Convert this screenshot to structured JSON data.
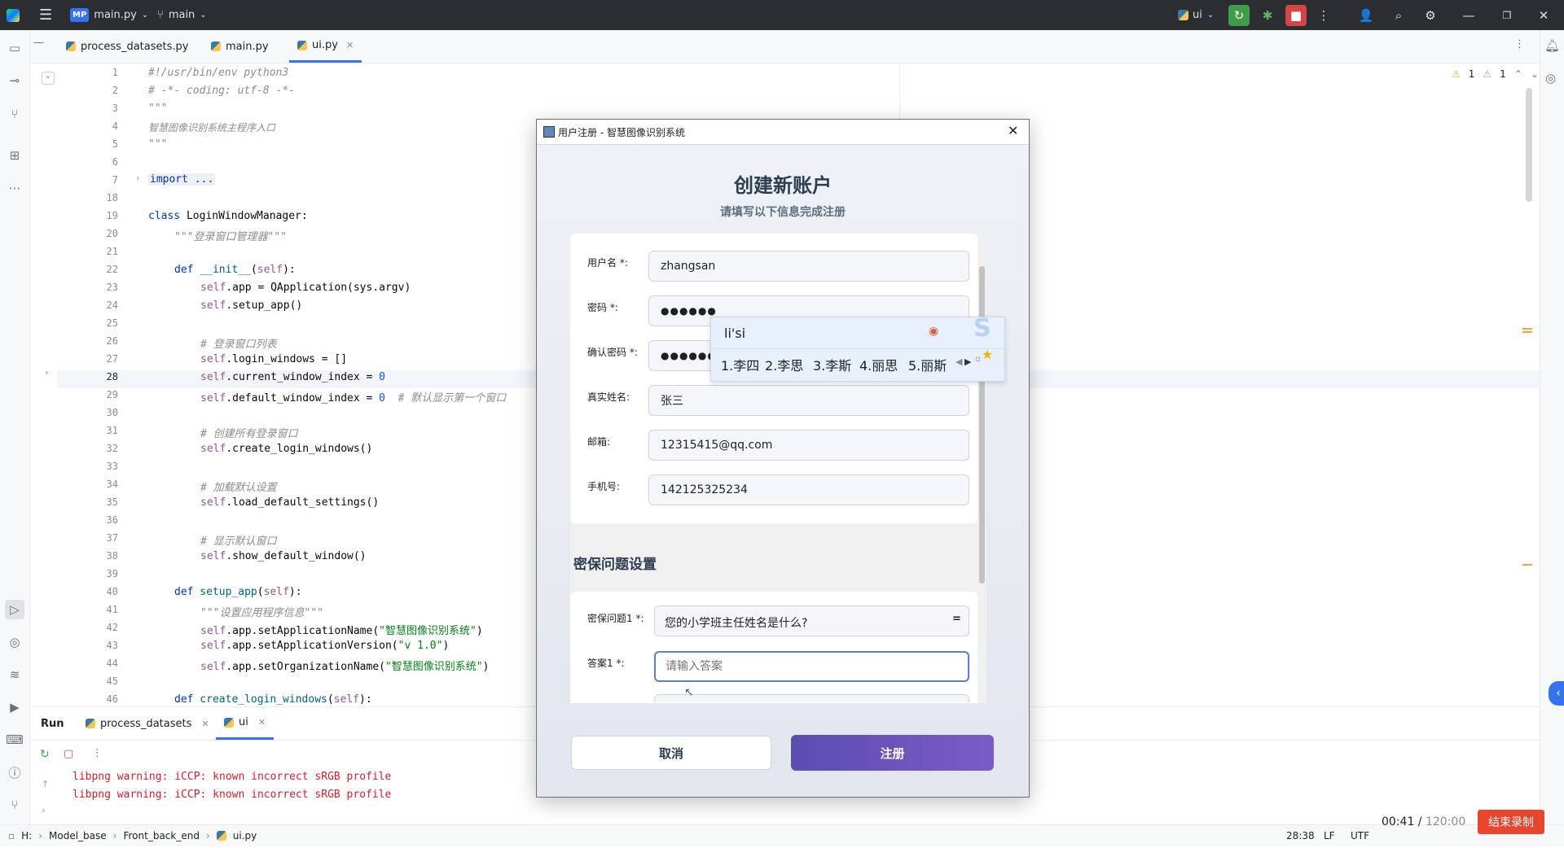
{
  "topbar": {
    "project_badge": "MP",
    "project_name": "main.py",
    "branch": "main",
    "run_config": "ui"
  },
  "tabs": [
    {
      "label": "process_datasets.py"
    },
    {
      "label": "main.py"
    },
    {
      "label": "ui.py"
    }
  ],
  "editor": {
    "inspections": {
      "warnings": "1",
      "weak_warnings": "1"
    },
    "lines": [
      {
        "n": "1",
        "top": 0
      },
      {
        "n": "2"
      },
      {
        "n": "3"
      },
      {
        "n": "4"
      },
      {
        "n": "5"
      },
      {
        "n": "6"
      },
      {
        "n": "7"
      },
      {
        "n": "18"
      },
      {
        "n": "19"
      },
      {
        "n": "20"
      },
      {
        "n": "21"
      },
      {
        "n": "22"
      },
      {
        "n": "23"
      },
      {
        "n": "24"
      },
      {
        "n": "25"
      },
      {
        "n": "26"
      },
      {
        "n": "27"
      },
      {
        "n": "28"
      },
      {
        "n": "29"
      },
      {
        "n": "30"
      },
      {
        "n": "31"
      },
      {
        "n": "32"
      },
      {
        "n": "33"
      },
      {
        "n": "34"
      },
      {
        "n": "35"
      },
      {
        "n": "36"
      },
      {
        "n": "37"
      },
      {
        "n": "38"
      },
      {
        "n": "39"
      },
      {
        "n": "40"
      },
      {
        "n": "41"
      },
      {
        "n": "42"
      },
      {
        "n": "43"
      },
      {
        "n": "44"
      },
      {
        "n": "45"
      },
      {
        "n": "46"
      }
    ],
    "code": {
      "l1": "#!/usr/bin/env python3",
      "l2": "# -*- coding: utf-8 -*-",
      "l3": "\"\"\"",
      "l4": "智慧图像识别系统主程序入口",
      "l5": "\"\"\"",
      "l7": "import ...",
      "l19_kw": "class",
      "l19_rest": " LoginWindowManager:",
      "l20": "\"\"\"登录窗口管理器\"\"\"",
      "l22_kw": "def",
      "l22_fn": " __init__",
      "l22_p1": "(",
      "l22_self": "self",
      "l22_p2": "):",
      "l23_self": "self",
      "l23_rest": ".app = QApplication(sys.argv)",
      "l24_self": "self",
      "l24_rest": ".setup_app()",
      "l26": "# 登录窗口列表",
      "l27_self": "self",
      "l27_rest": ".login_windows = []",
      "l28_self": "self",
      "l28_rest": ".current_window_index = ",
      "l28_num": "0",
      "l29_self": "self",
      "l29_rest": ".default_window_index = ",
      "l29_num": "0",
      "l29_cm": "  # 默认显示第一个窗口",
      "l31": "# 创建所有登录窗口",
      "l32_self": "self",
      "l32_rest": ".create_login_windows()",
      "l34": "# 加载默认设置",
      "l35_self": "self",
      "l35_rest": ".load_default_settings()",
      "l37": "# 显示默认窗口",
      "l38_self": "self",
      "l38_rest": ".show_default_window()",
      "l40_kw": "def",
      "l40_fn": " setup_app",
      "l40_p1": "(",
      "l40_self": "self",
      "l40_p2": "):",
      "l41": "\"\"\"设置应用程序信息\"\"\"",
      "l42_self": "self",
      "l42_rest": ".app.setApplicationName(",
      "l42_str": "\"智慧图像识别系统\"",
      "l42_end": ")",
      "l43_self": "self",
      "l43_rest": ".app.setApplicationVersion(",
      "l43_str": "\"v 1.0\"",
      "l43_end": ")",
      "l44_self": "self",
      "l44_rest": ".app.setOrganizationName(",
      "l44_str": "\"智慧图像识别系统\"",
      "l44_end": ")",
      "l46_kw": "def",
      "l46_fn": " create_login_windows",
      "l46_p1": "(",
      "l46_self": "self",
      "l46_p2": "):"
    }
  },
  "run_panel": {
    "title": "Run",
    "tabs": [
      {
        "label": "process_datasets"
      },
      {
        "label": "ui"
      }
    ],
    "log": [
      "libpng warning: iCCP: known incorrect sRGB profile",
      "libpng warning: iCCP: known incorrect sRGB profile"
    ]
  },
  "statusbar": {
    "breadcrumb": [
      "H:",
      "Model_base",
      "Front_back_end",
      "ui.py"
    ],
    "position": "28:38",
    "line_sep": "LF",
    "encoding": "UTF"
  },
  "recording": {
    "elapsed": "00:41",
    "separator": " / ",
    "total": "120:00",
    "stop_label": "结束录制"
  },
  "dialog": {
    "title": "用户注册 - 智慧图像识别系统",
    "heading": "创建新账户",
    "subheading": "请填写以下信息完成注册",
    "fields": {
      "username": {
        "label": "用户名 *:",
        "value": "zhangsan"
      },
      "password": {
        "label": "密码 *:",
        "value": "●●●●●●"
      },
      "confirm": {
        "label": "确认密码 *:",
        "value": "●●●●●●"
      },
      "realname": {
        "label": "真实姓名:",
        "value": "张三"
      },
      "email": {
        "label": "邮箱:",
        "value": "12315415@qq.com"
      },
      "phone": {
        "label": "手机号:",
        "value": "142125325234"
      }
    },
    "security": {
      "section_title": "密保问题设置",
      "q1_label": "密保问题1 *:",
      "q1_value": "您的小学班主任姓名是什么?",
      "a1_label": "答案1 *:",
      "a1_placeholder": "请输入答案"
    },
    "buttons": {
      "cancel": "取消",
      "register": "注册"
    }
  },
  "ime": {
    "composition": "li'si",
    "candidates": [
      "1.李四",
      "2.李思",
      "3.李斯",
      "4.丽思",
      "5.丽斯"
    ]
  },
  "colors": {
    "accent": "#3574f0",
    "register_button": "#6a53b8",
    "record_button": "#e8452c",
    "warning": "#f2a33a"
  }
}
